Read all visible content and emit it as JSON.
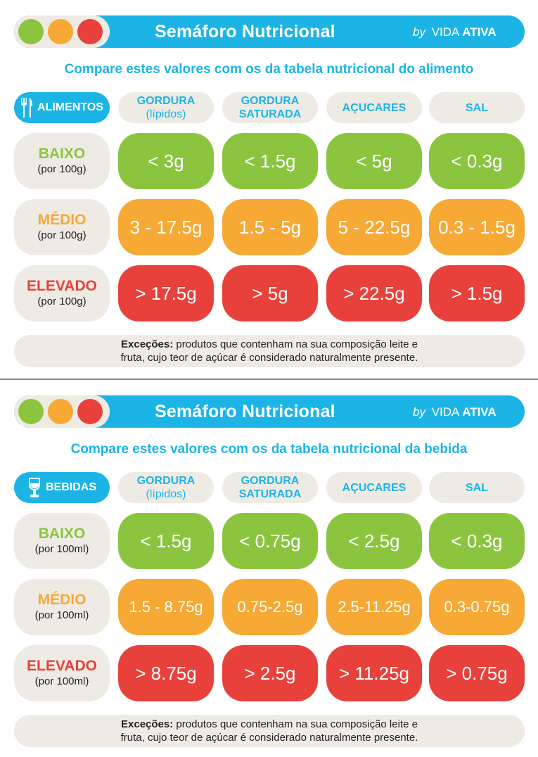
{
  "top": {
    "header": {
      "title": "Semáforo Nutricional",
      "by": "by",
      "brand_a": "VIDA",
      "brand_b": "ATIVA"
    },
    "subtitle": "Compare estes valores com os da tabela nutricional do alimento",
    "category": "ALIMENTOS",
    "category_icon": "fork-knife-icon",
    "columns": [
      {
        "label": "GORDURA",
        "sub": "(lípidos)"
      },
      {
        "label": "GORDURA",
        "sub": "SATURADA"
      },
      {
        "label": "AÇUCARES",
        "sub": ""
      },
      {
        "label": "SAL",
        "sub": ""
      }
    ],
    "rows": [
      {
        "level": "BAIXO",
        "unit": "(por 100g)",
        "color": "#8bc53f",
        "values": [
          "< 3g",
          "< 1.5g",
          "< 5g",
          "< 0.3g"
        ]
      },
      {
        "level": "MÉDIO",
        "unit": "(por 100g)",
        "color": "#f6a935",
        "values": [
          "3 - 17.5g",
          "1.5 - 5g",
          "5 - 22.5g",
          "0.3 - 1.5g"
        ]
      },
      {
        "level": "ELEVADO",
        "unit": "(por 100g)",
        "color": "#e8413b",
        "values": [
          "> 17.5g",
          "> 5g",
          "> 22.5g",
          "> 1.5g"
        ]
      }
    ],
    "note": {
      "bold": "Exceções:",
      "line1": " produtos que contenham na sua composição leite e",
      "line2": "fruta, cujo teor de açúcar é considerado naturalmente presente."
    }
  },
  "bottom": {
    "header": {
      "title": "Semáforo Nutricional",
      "by": "by",
      "brand_a": "VIDA",
      "brand_b": "ATIVA"
    },
    "subtitle": "Compare estes valores com os da tabela nutricional da bebida",
    "category": "BEBIDAS",
    "category_icon": "wine-glass-icon",
    "columns": [
      {
        "label": "GORDURA",
        "sub": "(lípidos)"
      },
      {
        "label": "GORDURA",
        "sub": "SATURADA"
      },
      {
        "label": "AÇUCARES",
        "sub": ""
      },
      {
        "label": "SAL",
        "sub": ""
      }
    ],
    "rows": [
      {
        "level": "BAIXO",
        "unit": "(por 100ml)",
        "color": "#8bc53f",
        "values": [
          "< 1.5g",
          "< 0.75g",
          "< 2.5g",
          "< 0.3g"
        ]
      },
      {
        "level": "MÉDIO",
        "unit": "(por 100ml)",
        "color": "#f6a935",
        "values": [
          "1.5 - 8.75g",
          "0.75-2.5g",
          "2.5-11.25g",
          "0.3-0.75g"
        ]
      },
      {
        "level": "ELEVADO",
        "unit": "(por 100ml)",
        "color": "#e8413b",
        "values": [
          "> 8.75g",
          "> 2.5g",
          "> 11.25g",
          "> 0.75g"
        ]
      }
    ],
    "note": {
      "bold": "Exceções:",
      "line1": " produtos que contenham na sua composição leite e",
      "line2": "fruta, cujo teor de açúcar é considerado naturalmente presente."
    }
  },
  "colors": {
    "brand_blue": "#1cb4e5",
    "panel_beige": "#eeebe4",
    "green": "#8bc53f",
    "orange": "#f6a935",
    "red": "#e8413b"
  }
}
